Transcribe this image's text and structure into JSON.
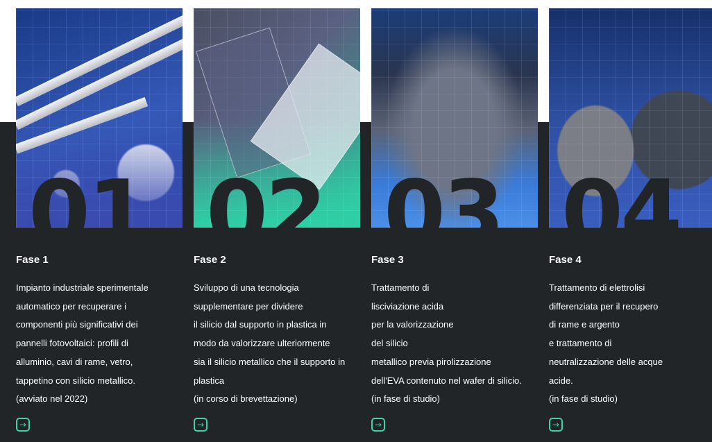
{
  "cards": [
    {
      "number": "01",
      "title": "Fase 1",
      "lines": [
        "Impianto industriale sperimentale",
        "automatico per recuperare i",
        "componenti più significativi dei",
        "pannelli fotovoltaici: profili di",
        "alluminio, cavi di rame, vetro,",
        "tappetino con silicio metallico.",
        "(avviato nel 2022)"
      ],
      "arrow_icon": "→"
    },
    {
      "number": "02",
      "title": "Fase 2",
      "lines": [
        "Sviluppo di una tecnologia",
        "supplementare per dividere",
        "il silicio dal supporto in plastica in",
        "modo da valorizzare ulteriormente",
        "sia il silicio metallico che il supporto in",
        "plastica",
        "(in corso di brevettazione)"
      ],
      "arrow_icon": "→"
    },
    {
      "number": "03",
      "title": "Fase 3",
      "lines": [
        "Trattamento di",
        "lisciviazione acida",
        "per la valorizzazione",
        "del silicio",
        "metallico previa pirolizzazione",
        "dell'EVA contenuto nel wafer di silicio.",
        "(in fase di studio)"
      ],
      "arrow_icon": "→"
    },
    {
      "number": "04",
      "title": "Fase 4",
      "lines": [
        "Trattamento di elettrolisi",
        "differenziata per il recupero",
        "di rame e argento",
        "e trattamento di",
        "neutralizzazione delle acque",
        "acide.",
        "(in fase di studio)"
      ],
      "arrow_icon": "→"
    }
  ],
  "colors": {
    "dark_background": "#222528",
    "accent": "#3ed3a1",
    "text": "#ffffff"
  }
}
